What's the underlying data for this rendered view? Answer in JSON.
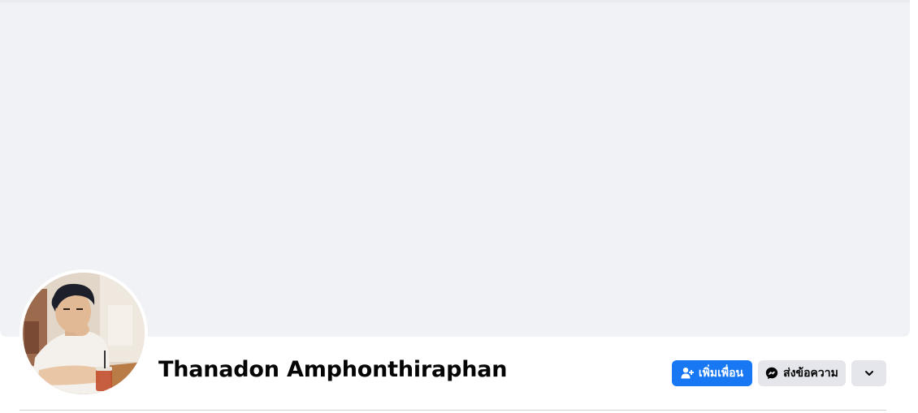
{
  "profile": {
    "name": "Thanadon Amphonthiraphan",
    "avatar_icon": "profile-photo"
  },
  "actions": {
    "add_friend_label": "เพิ่มเพื่อน",
    "add_friend_icon": "person-add-icon",
    "message_label": "ส่งข้อความ",
    "message_icon": "messenger-icon",
    "more_icon": "chevron-down-icon"
  },
  "colors": {
    "primary": "#1877f2",
    "secondary_button": "#e4e6eb",
    "cover_background": "#f0f2f5",
    "text": "#050505"
  }
}
